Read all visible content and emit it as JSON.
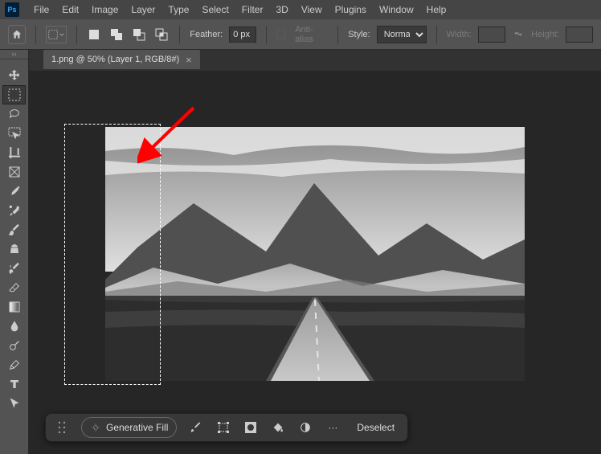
{
  "app": {
    "logo_text": "Ps"
  },
  "menu": {
    "file": "File",
    "edit": "Edit",
    "image": "Image",
    "layer": "Layer",
    "type": "Type",
    "select": "Select",
    "filter": "Filter",
    "threeD": "3D",
    "view": "View",
    "plugins": "Plugins",
    "window": "Window",
    "help": "Help"
  },
  "options": {
    "feather_label": "Feather:",
    "feather_value": "0 px",
    "antialias": "Anti-alias",
    "style_label": "Style:",
    "style_value": "Normal",
    "width_label": "Width:",
    "height_label": "Height:"
  },
  "tab": {
    "title": "1.png @ 50% (Layer 1, RGB/8#)",
    "close": "×"
  },
  "context": {
    "genfill": "Generative Fill",
    "deselect": "Deselect",
    "more": "···"
  },
  "tool_names": {
    "move": "move-tool",
    "marquee": "rectangular-marquee-tool",
    "lasso": "lasso-tool",
    "objsel": "object-selection-tool",
    "crop": "crop-tool",
    "frame": "frame-tool",
    "eyedrop": "eyedropper-tool",
    "heal": "spot-healing-brush-tool",
    "brush": "brush-tool",
    "stamp": "clone-stamp-tool",
    "history": "history-brush-tool",
    "eraser": "eraser-tool",
    "gradient": "gradient-tool",
    "blur": "blur-tool",
    "dodge": "dodge-tool",
    "pen": "pen-tool",
    "text": "type-tool",
    "path": "path-selection-tool"
  }
}
